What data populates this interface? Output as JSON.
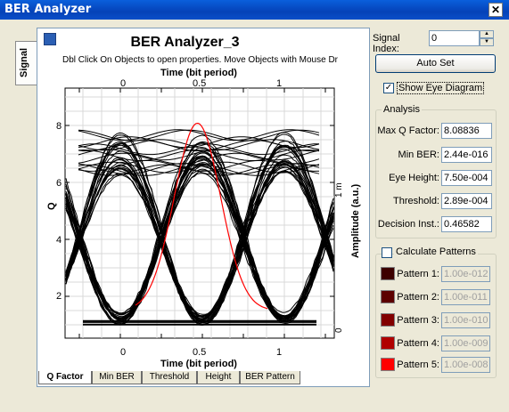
{
  "window": {
    "title": "BER Analyzer"
  },
  "side_tab": {
    "label": "Signal"
  },
  "graph": {
    "title": "BER Analyzer_3",
    "subtitle": "Dbl Click On Objects to open properties.  Move Objects with Mouse Dr",
    "top_axis_label": "Time (bit period)",
    "bottom_axis_label": "Time (bit period)",
    "left_axis_label": "Q",
    "right_axis_label": "Amplitude (a.u.)",
    "top_ticks": [
      "0",
      "0.5",
      "1"
    ],
    "bottom_ticks": [
      "0",
      "0.5",
      "1"
    ],
    "left_ticks": [
      "8",
      "6",
      "4",
      "2"
    ],
    "right_ticks": [
      "1 m",
      "0"
    ],
    "q_curve_color": "#ff0000",
    "eye_color": "#000000"
  },
  "bottom_tabs": [
    "Q Factor",
    "Min BER",
    "Threshold",
    "Height",
    "BER Pattern"
  ],
  "controls": {
    "signal_index_label": "Signal Index:",
    "signal_index_value": "0",
    "auto_set_label": "Auto Set",
    "show_eye_label": "Show Eye Diagram",
    "show_eye_checked": "✓"
  },
  "analysis": {
    "title": "Analysis",
    "rows": [
      {
        "label": "Max Q Factor:",
        "value": "8.08836"
      },
      {
        "label": "Min BER:",
        "value": "2.44e-016"
      },
      {
        "label": "Eye Height:",
        "value": "7.50e-004"
      },
      {
        "label": "Threshold:",
        "value": "2.89e-004"
      },
      {
        "label": "Decision Inst.:",
        "value": "0.46582"
      }
    ]
  },
  "patterns": {
    "title": "Calculate Patterns",
    "rows": [
      {
        "label": "Pattern 1:",
        "value": "1.00e-012",
        "color": "#3c0000"
      },
      {
        "label": "Pattern 2:",
        "value": "1.00e-011",
        "color": "#5c0000"
      },
      {
        "label": "Pattern 3:",
        "value": "1.00e-010",
        "color": "#820000"
      },
      {
        "label": "Pattern 4:",
        "value": "1.00e-009",
        "color": "#b00000"
      },
      {
        "label": "Pattern 5:",
        "value": "1.00e-008",
        "color": "#ff0000"
      }
    ]
  }
}
